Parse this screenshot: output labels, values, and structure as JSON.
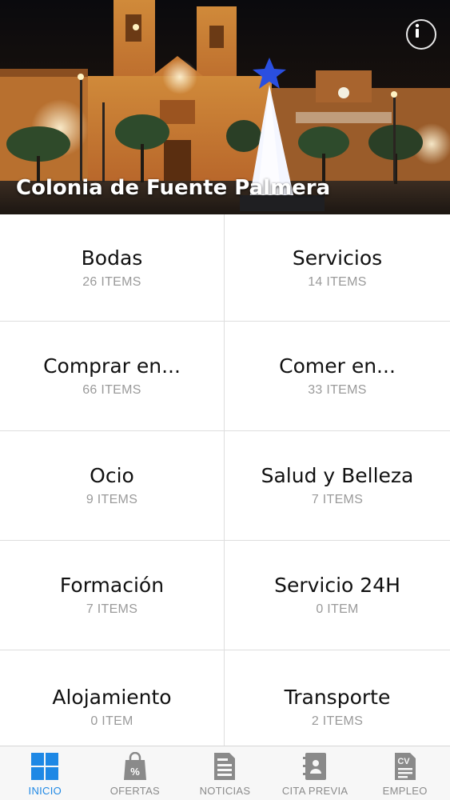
{
  "header": {
    "title": "Colonia de Fuente Palmera",
    "info_icon": "info-icon"
  },
  "categories": [
    {
      "title": "Bodas",
      "count": "26 ITEMS"
    },
    {
      "title": "Servicios",
      "count": "14 ITEMS"
    },
    {
      "title": "Comprar en...",
      "count": "66 ITEMS"
    },
    {
      "title": "Comer en...",
      "count": "33 ITEMS"
    },
    {
      "title": "Ocio",
      "count": "9 ITEMS"
    },
    {
      "title": "Salud y Belleza",
      "count": "7 ITEMS"
    },
    {
      "title": "Formación",
      "count": "7 ITEMS"
    },
    {
      "title": "Servicio 24H",
      "count": "0 ITEM"
    },
    {
      "title": "Alojamiento",
      "count": "0 ITEM"
    },
    {
      "title": "Transporte",
      "count": "2 ITEMS"
    }
  ],
  "tabbar": {
    "active_color": "#1e88e5",
    "inactive_color": "#8a8a8a",
    "tabs": [
      {
        "label": "INICIO",
        "icon": "grid-icon",
        "active": true
      },
      {
        "label": "OFERTAS",
        "icon": "shopping-bag-icon"
      },
      {
        "label": "NOTICIAS",
        "icon": "newspaper-icon"
      },
      {
        "label": "CITA PREVIA",
        "icon": "contacts-book-icon"
      },
      {
        "label": "EMPLEO",
        "icon": "cv-document-icon"
      }
    ]
  }
}
